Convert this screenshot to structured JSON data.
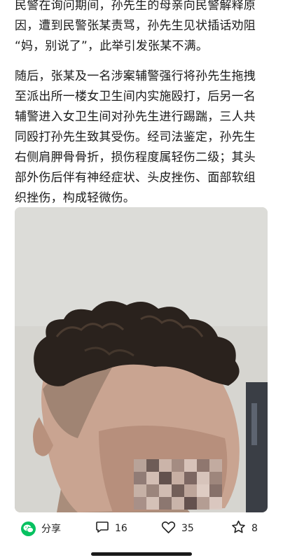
{
  "article": {
    "paragraph_1": "民警在询问期间，孙先生的母亲向民警解释原\n因，遭到民警张某责骂，孙先生见状插话劝阻\n“妈，别说了”，此举引发张某不满。",
    "paragraph_2": "随后，张某及一名涉案辅警强行将孙先生拖拽\n至派出所一楼女卫生间内实施殴打，后另一名\n辅警进入女卫生间对孙先生进行踢踹，三人共\n同殴打孙先生致其受伤。经司法鉴定，孙先生\n右侧肩胛骨骨折，损伤程度属轻伤二级；其头\n部外伤后伴有神经症状、头皮挫伤、面部软组\n织挫伤，构成轻微伤。"
  },
  "actions": {
    "share": {
      "label": "分享",
      "icon": "wechat-icon"
    },
    "comment": {
      "count": "16",
      "icon": "comment-icon"
    },
    "like": {
      "count": "35",
      "icon": "heart-icon"
    },
    "favorite": {
      "count": "8",
      "icon": "star-icon"
    }
  },
  "colors": {
    "text": "#1a1a1a",
    "wechat_green": "#07c160"
  }
}
